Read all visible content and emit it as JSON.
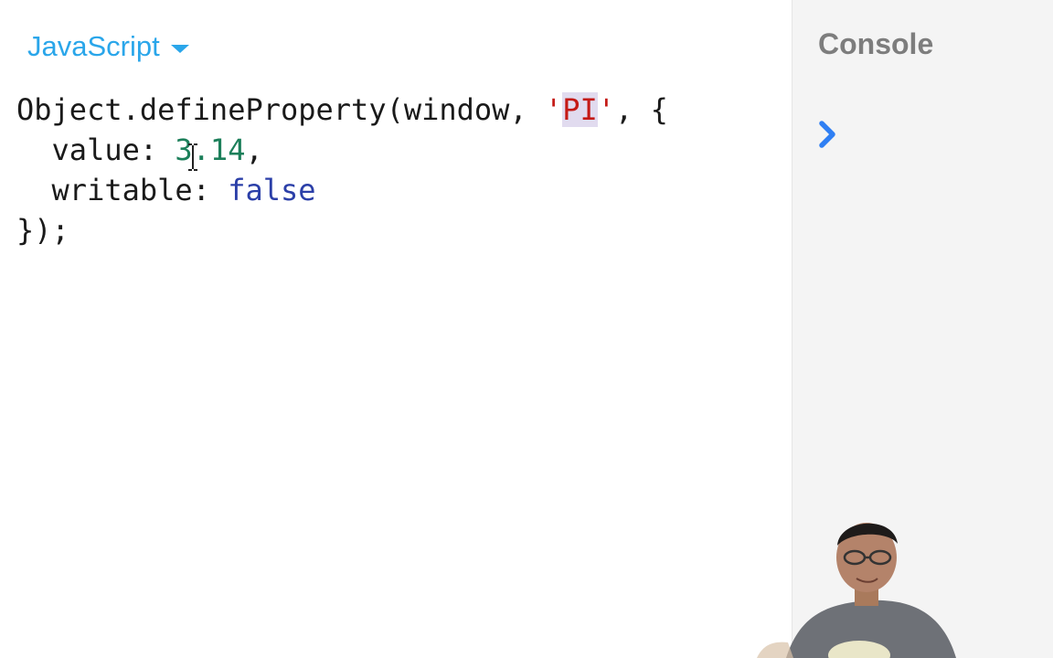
{
  "editor": {
    "language": "JavaScript",
    "code": {
      "l1_a": "Object.defineProperty(window, ",
      "l1_q1": "'",
      "l1_sel": "PI",
      "l1_q2": "'",
      "l1_b": ", {",
      "l2_key": "  value: ",
      "l2_num": "3.14",
      "l2_end": ",",
      "l3_key": "  writable: ",
      "l3_val": "false",
      "l4": "});"
    }
  },
  "console": {
    "title": "Console",
    "prompt_icon": "chevron-right-icon"
  },
  "colors": {
    "accent": "#2aa6ea",
    "string": "#c41a16",
    "number": "#1c7f5a",
    "keyword": "#2b3fa8",
    "selection": "#e1dbef",
    "console_bg": "#f4f4f4",
    "prompt": "#2f7ff3"
  }
}
